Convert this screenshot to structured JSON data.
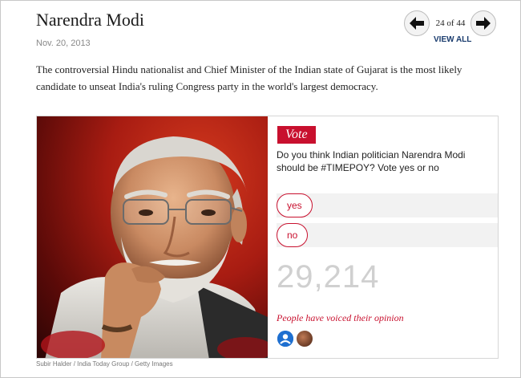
{
  "article": {
    "title": "Narendra Modi",
    "date": "Nov. 20, 2013",
    "description": "The controversial Hindu nationalist and Chief Minister of the Indian state of Gujarat is the most likely candidate to unseat India's ruling Congress party in the world's largest democracy."
  },
  "gallery_nav": {
    "counter": "24 of 44",
    "view_all": "VIEW ALL",
    "prev_icon": "arrow-left-icon",
    "next_icon": "arrow-right-icon"
  },
  "photo": {
    "subject": "portrait of Narendra Modi",
    "caption": "Subir Halder / India Today Group / Getty Images"
  },
  "poll": {
    "badge": "Vote",
    "question": "Do you think Indian politician Narendra Modi should be #TIMEPOY? Vote yes or no",
    "options": [
      "yes",
      "no"
    ],
    "count": "29,214",
    "voiced_text": "People have voiced their opinion"
  },
  "colors": {
    "accent": "#c8102e",
    "link": "#1a3c6e",
    "count_gray": "#d0d0d0"
  }
}
